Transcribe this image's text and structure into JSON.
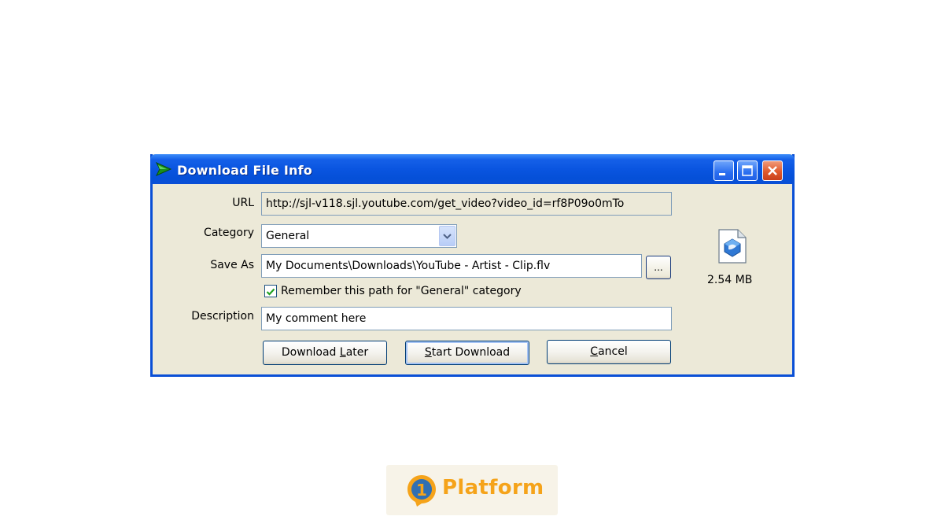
{
  "window": {
    "title": "Download File Info"
  },
  "form": {
    "url_label": "URL",
    "url_value": "http://sjl-v118.sjl.youtube.com/get_video?video_id=rf8P09o0mTo",
    "category_label": "Category",
    "category_value": "General",
    "saveas_label": "Save As",
    "saveas_value": "My Documents\\Downloads\\YouTube - Artist - Clip.flv",
    "browse_label": "...",
    "remember_label": "Remember this path for \"General\" category",
    "remember_checked": true,
    "description_label": "Description",
    "description_value": "My comment here"
  },
  "file": {
    "size": "2.54  MB",
    "icon": "flv-file-icon"
  },
  "buttons": {
    "download_later_pre": "Download ",
    "download_later_key": "L",
    "download_later_post": "ater",
    "start_download_pre": "",
    "start_download_key": "S",
    "start_download_post": "tart Download",
    "cancel_pre": "",
    "cancel_key": "C",
    "cancel_post": "ancel"
  },
  "brand": {
    "name": "Platform",
    "mark_digit": "1"
  },
  "colors": {
    "titlebar": "#0a55e0",
    "dialog_bg": "#ece9d8",
    "close_button": "#e05a2c",
    "brand_orange": "#f5a31a",
    "brand_blue": "#2f6fb3"
  }
}
